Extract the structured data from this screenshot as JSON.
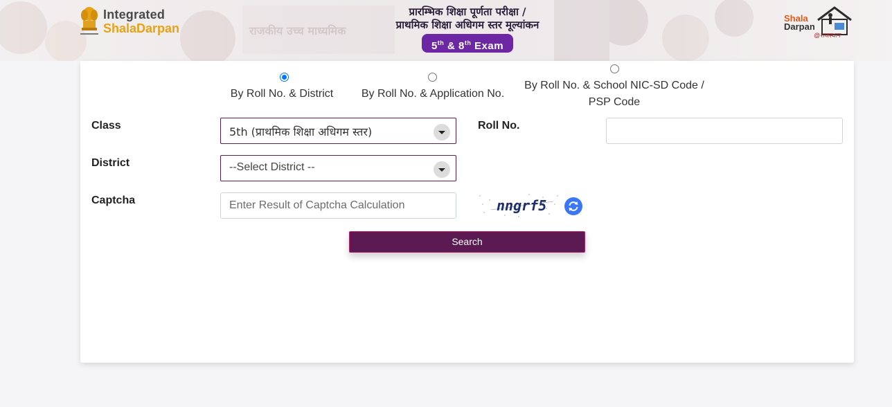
{
  "header": {
    "logo_line1": "Integrated",
    "logo_line2_a": "Shala",
    "logo_line2_b": "Darpan",
    "title_line1": "प्रारम्भिक शिक्षा पूर्णता परीक्षा /",
    "title_line2": "प्राथमिक शिक्षा अधिगम स्तर मूल्यांकन",
    "exam_5": "5",
    "exam_th1": "th",
    "exam_amp": "&",
    "exam_8": "8",
    "exam_th2": "th",
    "exam_word": "Exam",
    "right_logo_l1": "Shala",
    "right_logo_l2": "Darpan",
    "right_logo_tag": "@राजस्थान"
  },
  "search_mode": {
    "selected": "By Roll No. & District",
    "options": [
      {
        "label": "By Roll No. & District"
      },
      {
        "label": "By Roll No. & Application No."
      },
      {
        "label_l1": "By Roll No. & School NIC-SD Code /",
        "label_l2": "PSP Code"
      }
    ]
  },
  "form": {
    "class_label": "Class",
    "class_value": "5th (प्राथमिक शिक्षा अधिगम स्तर)",
    "roll_label": "Roll No.",
    "roll_value": "",
    "district_label": "District",
    "district_value": "--Select District --",
    "captcha_label": "Captcha",
    "captcha_placeholder": "Enter Result of Captcha Calculation",
    "captcha_text": "nngrf5",
    "search_label": "Search"
  },
  "colors": {
    "brand_purple": "#5b1a52",
    "exam_pill": "#6d27a5",
    "accent_orange": "#e8a215",
    "refresh_blue": "#3b76f6"
  }
}
